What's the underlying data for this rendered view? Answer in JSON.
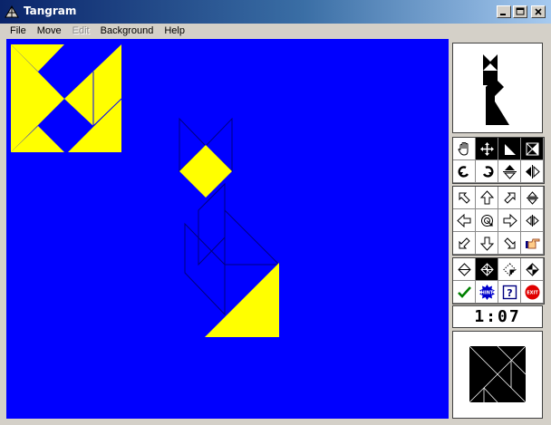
{
  "window": {
    "title": "Tangram",
    "icon": "tangram-app-icon",
    "caption_buttons": [
      {
        "name": "minimize",
        "label": "_"
      },
      {
        "name": "maximize",
        "label": "□"
      },
      {
        "name": "close",
        "label": "X"
      }
    ]
  },
  "menu": [
    {
      "label": "File",
      "enabled": true
    },
    {
      "label": "Move",
      "enabled": true
    },
    {
      "label": "Edit",
      "enabled": false
    },
    {
      "label": "Background",
      "enabled": true
    },
    {
      "label": "Help",
      "enabled": true
    }
  ],
  "colors": {
    "board": "#0000ff",
    "piece": "#ffff00",
    "outline": "#000080",
    "silhouette": "#000000",
    "chrome": "#d4d0c8"
  },
  "toolbar_top": [
    {
      "icon": "hand-icon",
      "active": false
    },
    {
      "icon": "move-arrows-icon",
      "active": true
    },
    {
      "icon": "triangle-select-icon",
      "active": true
    },
    {
      "icon": "x-select-icon",
      "active": true
    },
    {
      "icon": "rotate-left-icon",
      "active": false
    },
    {
      "icon": "rotate-right-icon",
      "active": false
    },
    {
      "icon": "flip-vertical-icon",
      "active": false
    },
    {
      "icon": "flip-horizontal-icon",
      "active": false
    }
  ],
  "toolbar_arrows": [
    {
      "icon": "arrow-up-left-icon"
    },
    {
      "icon": "arrow-up-icon"
    },
    {
      "icon": "arrow-up-right-icon"
    },
    {
      "icon": "flip-vertical-small-icon"
    },
    {
      "icon": "arrow-left-icon"
    },
    {
      "icon": "center-icon"
    },
    {
      "icon": "arrow-right-icon"
    },
    {
      "icon": "flip-horizontal-small-icon"
    },
    {
      "icon": "arrow-down-left-icon"
    },
    {
      "icon": "arrow-down-icon"
    },
    {
      "icon": "arrow-down-right-icon"
    },
    {
      "icon": "pointing-hand-icon"
    }
  ],
  "toolbar_bottom": [
    {
      "icon": "outline-mode-icon",
      "active": false
    },
    {
      "icon": "grid-mode-icon",
      "active": true
    },
    {
      "icon": "dotted-mode-icon",
      "active": false
    },
    {
      "icon": "solid-mode-icon",
      "active": false
    },
    {
      "icon": "check-icon",
      "active": false
    },
    {
      "icon": "hint-badge-icon",
      "active": false,
      "label": "HINT"
    },
    {
      "icon": "help-icon",
      "active": false,
      "label": "?"
    },
    {
      "icon": "exit-icon",
      "active": false,
      "label": "EXIT"
    }
  ],
  "timer": {
    "value": "1:07"
  }
}
